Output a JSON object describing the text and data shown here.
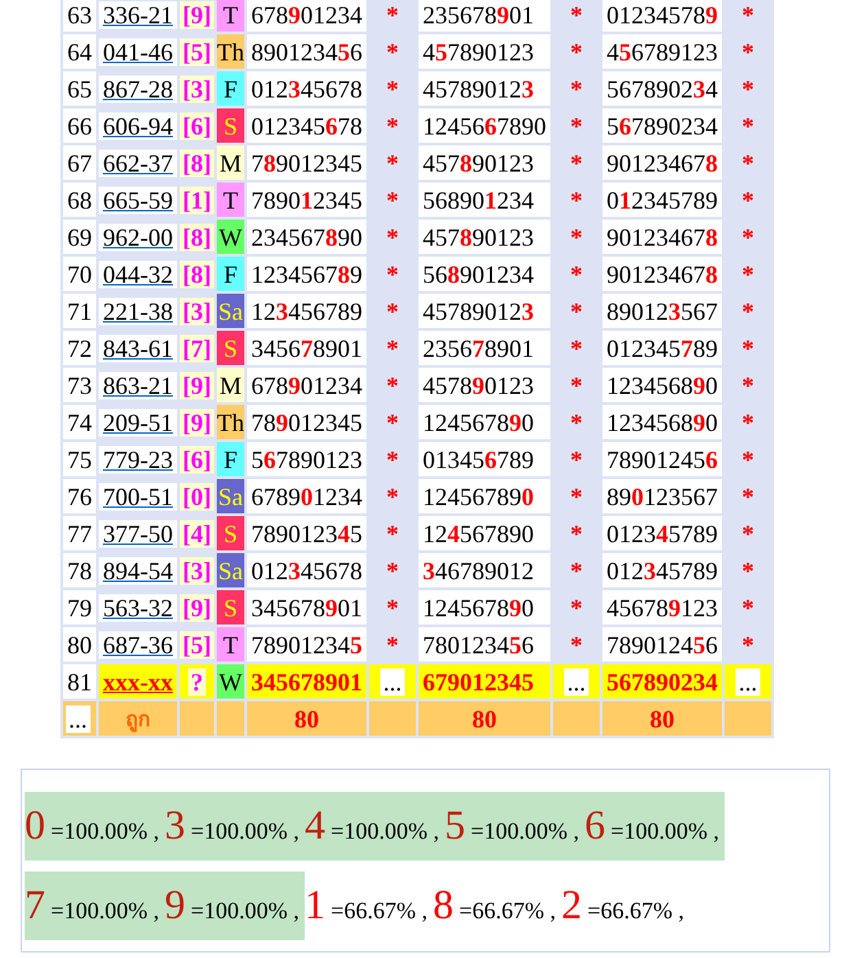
{
  "table": {
    "rows": [
      {
        "kind": "result",
        "index": "63",
        "code": "336-21",
        "digit": "[9]",
        "day": {
          "label": "T",
          "color": "#ff99ff"
        },
        "cells": [
          {
            "number": "678**9**01234",
            "mark": "*"
          },
          {
            "number": "235678**9**01",
            "mark": "*"
          },
          {
            "number": "01234578**9**",
            "mark": "*"
          }
        ]
      },
      {
        "kind": "result",
        "index": "64",
        "code": "041-46",
        "digit": "[5]",
        "day": {
          "label": "Th",
          "color": "#ffcc66"
        },
        "cells": [
          {
            "number": "8901234**5**6",
            "mark": "*"
          },
          {
            "number": "4**5**7890123",
            "mark": "*"
          },
          {
            "number": "4**5**6789123",
            "mark": "*"
          }
        ]
      },
      {
        "kind": "result",
        "index": "65",
        "code": "867-28",
        "digit": "[3]",
        "day": {
          "label": "F",
          "color": "#66ffff"
        },
        "cells": [
          {
            "number": "012**3**45678",
            "mark": "*"
          },
          {
            "number": "45789012**3**",
            "mark": "*"
          },
          {
            "number": "5678902**3**4",
            "mark": "*"
          }
        ]
      },
      {
        "kind": "result",
        "index": "66",
        "code": "606-94",
        "digit": "[6]",
        "day": {
          "label": "S",
          "color": "#ff3366"
        },
        "cells": [
          {
            "number": "012345**6**78",
            "mark": "*"
          },
          {
            "number": "12456**6**7890",
            "mark": "*"
          },
          {
            "number": "5**6**7890234",
            "mark": "*"
          }
        ]
      },
      {
        "kind": "result",
        "index": "67",
        "code": "662-37",
        "digit": "[8]",
        "day": {
          "label": "M",
          "color": "#ffffcc"
        },
        "cells": [
          {
            "number": "7**8**9012345",
            "mark": "*"
          },
          {
            "number": "457**8**90123",
            "mark": "*"
          },
          {
            "number": "90123467**8**",
            "mark": "*"
          }
        ]
      },
      {
        "kind": "result",
        "index": "68",
        "code": "665-59",
        "digit": "[1]",
        "day": {
          "label": "T",
          "color": "#ff99ff"
        },
        "cells": [
          {
            "number": "7890**1**2345",
            "mark": "*"
          },
          {
            "number": "56890**1**234",
            "mark": "*"
          },
          {
            "number": "0**1**2345789",
            "mark": "*"
          }
        ]
      },
      {
        "kind": "result",
        "index": "69",
        "code": "962-00",
        "digit": "[8]",
        "day": {
          "label": "W",
          "color": "#66ff66"
        },
        "cells": [
          {
            "number": "234567**8**90",
            "mark": "*"
          },
          {
            "number": "457**8**90123",
            "mark": "*"
          },
          {
            "number": "90123467**8**",
            "mark": "*"
          }
        ]
      },
      {
        "kind": "result",
        "index": "70",
        "code": "044-32",
        "digit": "[8]",
        "day": {
          "label": "F",
          "color": "#66ffff"
        },
        "cells": [
          {
            "number": "1234567**8**9",
            "mark": "*"
          },
          {
            "number": "56**8**901234",
            "mark": "*"
          },
          {
            "number": "90123467**8**",
            "mark": "*"
          }
        ]
      },
      {
        "kind": "result",
        "index": "71",
        "code": "221-38",
        "digit": "[3]",
        "day": {
          "label": "Sa",
          "color": "#6666cc"
        },
        "cells": [
          {
            "number": "12**3**456789",
            "mark": "*"
          },
          {
            "number": "45789012**3**",
            "mark": "*"
          },
          {
            "number": "89012**3**567",
            "mark": "*"
          }
        ]
      },
      {
        "kind": "result",
        "index": "72",
        "code": "843-61",
        "digit": "[7]",
        "day": {
          "label": "S",
          "color": "#ff3366"
        },
        "cells": [
          {
            "number": "3456**7**8901",
            "mark": "*"
          },
          {
            "number": "2356**7**8901",
            "mark": "*"
          },
          {
            "number": "012345**7**89",
            "mark": "*"
          }
        ]
      },
      {
        "kind": "result",
        "index": "73",
        "code": "863-21",
        "digit": "[9]",
        "day": {
          "label": "M",
          "color": "#ffffcc"
        },
        "cells": [
          {
            "number": "678**9**01234",
            "mark": "*"
          },
          {
            "number": "4578**9**0123",
            "mark": "*"
          },
          {
            "number": "1234568**9**0",
            "mark": "*"
          }
        ]
      },
      {
        "kind": "result",
        "index": "74",
        "code": "209-51",
        "digit": "[9]",
        "day": {
          "label": "Th",
          "color": "#ffcc66"
        },
        "cells": [
          {
            "number": "78**9**012345",
            "mark": "*"
          },
          {
            "number": "1245678**9**0",
            "mark": "*"
          },
          {
            "number": "1234568**9**0",
            "mark": "*"
          }
        ]
      },
      {
        "kind": "result",
        "index": "75",
        "code": "779-23",
        "digit": "[6]",
        "day": {
          "label": "F",
          "color": "#66ffff"
        },
        "cells": [
          {
            "number": "5**6**7890123",
            "mark": "*"
          },
          {
            "number": "01345**6**789",
            "mark": "*"
          },
          {
            "number": "78901245**6**",
            "mark": "*"
          }
        ]
      },
      {
        "kind": "result",
        "index": "76",
        "code": "700-51",
        "digit": "[0]",
        "day": {
          "label": "Sa",
          "color": "#6666cc"
        },
        "cells": [
          {
            "number": "6789**0**1234",
            "mark": "*"
          },
          {
            "number": "12456789**0**",
            "mark": "*"
          },
          {
            "number": "89**0**123567",
            "mark": "*"
          }
        ]
      },
      {
        "kind": "result",
        "index": "77",
        "code": "377-50",
        "digit": "[4]",
        "day": {
          "label": "S",
          "color": "#ff3366"
        },
        "cells": [
          {
            "number": "7890123**4**5",
            "mark": "*"
          },
          {
            "number": "12**4**567890",
            "mark": "*"
          },
          {
            "number": "0123**4**5789",
            "mark": "*"
          }
        ]
      },
      {
        "kind": "result",
        "index": "78",
        "code": "894-54",
        "digit": "[3]",
        "day": {
          "label": "Sa",
          "color": "#6666cc"
        },
        "cells": [
          {
            "number": "012**3**45678",
            "mark": "*"
          },
          {
            "number": "**3**46789012",
            "mark": "*"
          },
          {
            "number": "012**3**45789",
            "mark": "*"
          }
        ]
      },
      {
        "kind": "result",
        "index": "79",
        "code": "563-32",
        "digit": "[9]",
        "day": {
          "label": "S",
          "color": "#ff3366"
        },
        "cells": [
          {
            "number": "345678**9**01",
            "mark": "*"
          },
          {
            "number": "1245678**9**0",
            "mark": "*"
          },
          {
            "number": "45678**9**123",
            "mark": "*"
          }
        ]
      },
      {
        "kind": "result",
        "index": "80",
        "code": "687-36",
        "digit": "[5]",
        "day": {
          "label": "T",
          "color": "#ff99ff"
        },
        "cells": [
          {
            "number": "78901234**5**",
            "mark": "*"
          },
          {
            "number": "7801234**5**6",
            "mark": "*"
          },
          {
            "number": "7890124**5**6",
            "mark": "*"
          }
        ]
      },
      {
        "kind": "pending",
        "index": "81",
        "code": "xxx-xx",
        "digit": "?",
        "day": {
          "label": "W",
          "color": "#66ff66"
        },
        "cells": [
          {
            "number": "345678901",
            "mark": "..."
          },
          {
            "number": "679012345",
            "mark": "..."
          },
          {
            "number": "567890234",
            "mark": "..."
          }
        ]
      }
    ],
    "footer": {
      "index": "...",
      "label": "ถูก",
      "counts": [
        "80",
        "80",
        "80"
      ]
    }
  },
  "stats": [
    {
      "digit": "0",
      "percent": "=100.00% ,",
      "highlighted": true
    },
    {
      "digit": "3",
      "percent": "=100.00% ,",
      "highlighted": true
    },
    {
      "digit": "4",
      "percent": "=100.00% ,",
      "highlighted": true
    },
    {
      "digit": "5",
      "percent": "=100.00% ,",
      "highlighted": true
    },
    {
      "digit": "6",
      "percent": "=100.00% ,",
      "highlighted": true
    },
    {
      "digit": "7",
      "percent": "=100.00% ,",
      "highlighted": true
    },
    {
      "digit": "9",
      "percent": "=100.00% ,",
      "highlighted": true
    },
    {
      "digit": "1",
      "percent": "=66.67% ,",
      "highlighted": false
    },
    {
      "digit": "8",
      "percent": "=66.67% ,",
      "highlighted": false
    },
    {
      "digit": "2",
      "percent": "=66.67% ,",
      "highlighted": false
    }
  ]
}
